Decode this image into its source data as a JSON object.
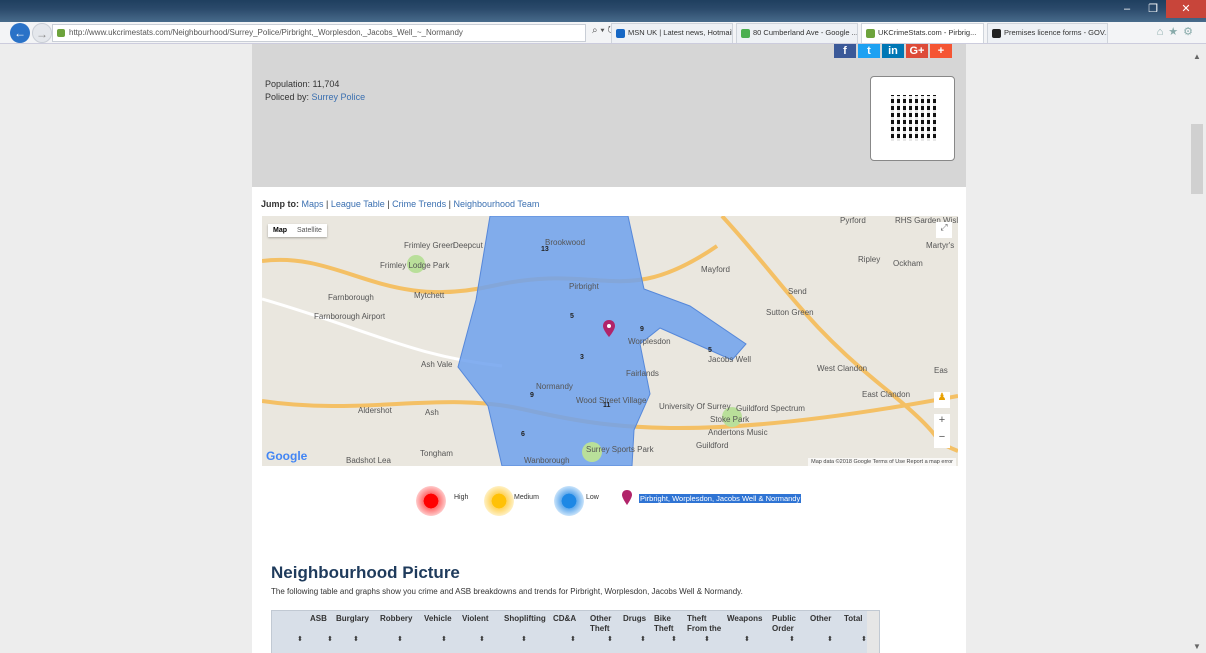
{
  "browser": {
    "url": "http://www.ukcrimestats.com/Neighbourhood/Surrey_Police/Pirbright,_Worplesdon,_Jacobs_Well_~_Normandy",
    "tabs": [
      {
        "title": "MSN UK | Latest news, Hotmail...",
        "active": false,
        "color": "#1667c4"
      },
      {
        "title": "80 Cumberland Ave - Google ...",
        "active": false,
        "color": "#4caf50"
      },
      {
        "title": "UKCrimeStats.com - Pirbrig...",
        "active": true,
        "color": "#6da33c"
      },
      {
        "title": "Premises licence forms - GOV....",
        "active": false,
        "color": "#222"
      }
    ]
  },
  "header": {
    "population_label": "Population: 11,704",
    "policed_label": "Policed by:",
    "policed_value": "Surrey Police",
    "social": [
      {
        "icon": "facebook-icon",
        "glyph": "f",
        "color": "#3b5998"
      },
      {
        "icon": "twitter-icon",
        "glyph": "t",
        "color": "#1da1f2"
      },
      {
        "icon": "linkedin-icon",
        "glyph": "in",
        "color": "#0077b5"
      },
      {
        "icon": "google-plus-icon",
        "glyph": "G+",
        "color": "#dd4b39"
      },
      {
        "icon": "add-icon",
        "glyph": "+",
        "color": "#f55533"
      }
    ]
  },
  "jump": {
    "label": "Jump to:",
    "links": [
      "Maps",
      "League Table",
      "Crime Trends",
      "Neighbourhood Team"
    ]
  },
  "map": {
    "toggle": [
      "Map",
      "Satellite"
    ],
    "places": [
      {
        "name": "Frimley Green"
      },
      {
        "name": "Deepcut"
      },
      {
        "name": "Brookwood"
      },
      {
        "name": "Frimley Lodge Park"
      },
      {
        "name": "Mayford"
      },
      {
        "name": "Martyr's"
      },
      {
        "name": "Ripley"
      },
      {
        "name": "Ockham"
      },
      {
        "name": "Farnborough"
      },
      {
        "name": "Mytchett"
      },
      {
        "name": "Send"
      },
      {
        "name": "Farnborough Airport"
      },
      {
        "name": "Pirbright"
      },
      {
        "name": "Sutton Green"
      },
      {
        "name": "Worplesdon"
      },
      {
        "name": "Jacobs Well"
      },
      {
        "name": "Ash Vale"
      },
      {
        "name": "West Clandon"
      },
      {
        "name": "Fairlands"
      },
      {
        "name": "Normandy"
      },
      {
        "name": "East Clandon"
      },
      {
        "name": "Aldershot"
      },
      {
        "name": "Ash"
      },
      {
        "name": "Wood Street Village"
      },
      {
        "name": "University Of Surrey"
      },
      {
        "name": "Guildford Spectrum"
      },
      {
        "name": "Stoke Park"
      },
      {
        "name": "Andertons Music"
      },
      {
        "name": "Guildford"
      },
      {
        "name": "Surrey Sports Park"
      },
      {
        "name": "Tongham"
      },
      {
        "name": "Badshot Lea"
      },
      {
        "name": "Wanborough"
      },
      {
        "name": "RHS Garden Wisley"
      },
      {
        "name": "Pyrford"
      },
      {
        "name": "Eas"
      }
    ],
    "wards": [
      "13",
      "5",
      "9",
      "3",
      "5",
      "9",
      "11",
      "6"
    ],
    "footer": "Map data ©2018 Google  Terms of Use  Report a map error"
  },
  "legend": {
    "high": "High",
    "medium": "Medium",
    "low": "Low",
    "area": "Pirbright, Worplesdon, Jacobs Well & Normandy"
  },
  "section": {
    "title": "Neighbourhood Picture",
    "intro": "The following table and graphs show you crime and ASB breakdowns and trends for Pirbright, Worplesdon, Jacobs Well & Normandy."
  },
  "table_headers": [
    "",
    "ASB",
    "Burglary",
    "Robbery",
    "Vehicle",
    "Violent",
    "Shoplifting",
    "CD&A",
    "Other Theft",
    "Drugs",
    "Bike Theft",
    "Theft From the",
    "Weapons",
    "Public Order",
    "Other",
    "Total"
  ]
}
